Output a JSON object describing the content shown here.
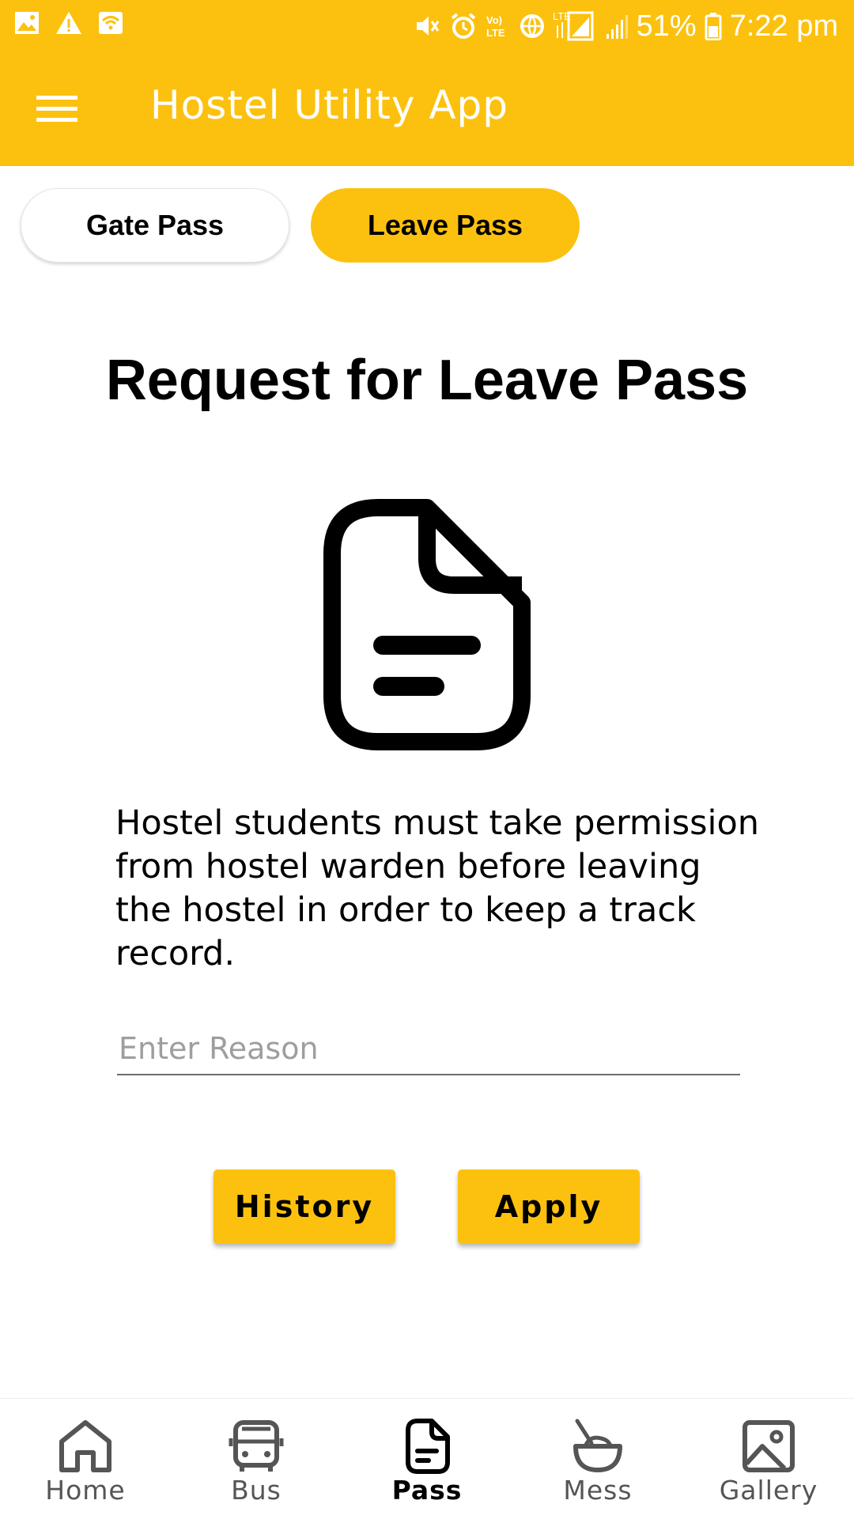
{
  "status_bar": {
    "battery": "51%",
    "time": "7:22 pm",
    "left_icons": [
      "image-icon",
      "warning-icon",
      "wifi-icon"
    ],
    "right_icons": [
      "mute-icon",
      "alarm-icon",
      "volte-icon",
      "data-icon",
      "lte-signal-icon",
      "signal-icon",
      "battery-icon"
    ]
  },
  "app_bar": {
    "title": "Hostel Utility App",
    "menu_icon": "hamburger-icon",
    "background": "#fcc10f"
  },
  "tabs": [
    {
      "label": "Gate Pass",
      "active": false
    },
    {
      "label": "Leave Pass",
      "active": true
    }
  ],
  "main": {
    "heading": "Request for Leave Pass",
    "icon": "document-icon",
    "description": "Hostel students must take permission from hostel warden before leaving the hostel in order to keep a track record.",
    "reason_input": {
      "value": "",
      "placeholder": "Enter Reason"
    },
    "buttons": {
      "history": "History",
      "apply": "Apply"
    }
  },
  "bottom_nav": {
    "items": [
      {
        "label": "Home",
        "icon": "home-icon",
        "active": false
      },
      {
        "label": "Bus",
        "icon": "bus-icon",
        "active": false
      },
      {
        "label": "Pass",
        "icon": "pass-icon",
        "active": true
      },
      {
        "label": "Mess",
        "icon": "mess-icon",
        "active": false
      },
      {
        "label": "Gallery",
        "icon": "gallery-icon",
        "active": false
      }
    ]
  },
  "colors": {
    "accent": "#fcc10f",
    "text": "#000000",
    "muted": "#555555",
    "placeholder": "#9e9e9e"
  }
}
